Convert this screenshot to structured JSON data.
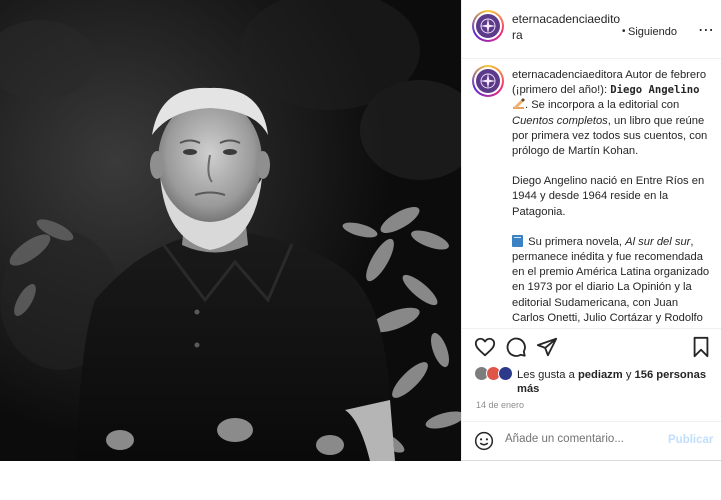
{
  "post": {
    "username": "eternacadenciaeditora",
    "follow_dot": "•",
    "follow_label": "Siguiendo",
    "more_label": "⋯",
    "photo_alt": "",
    "caption": {
      "username": "eternacadenciaeditora",
      "p1_intro": " Autor de febrero (¡primero del año!): ",
      "p1_name": "Diego Angelino",
      "p1_after_name": ". Se incorpora a la editorial con ",
      "p1_title": "Cuentos completos",
      "p1_end": ", un libro que reúne por primera vez todos sus cuentos, con prólogo de Martín Kohan.",
      "p2": "Diego Angelino nació en Entre Ríos en 1944 y desde 1964 reside en la Patagonia.",
      "p3_intro": "Su primera novela, ",
      "p3_title": "Al sur del sur",
      "p3_end": ", permanece inédita y fue recomendada en el premio América Latina organizado en 1973 por el diario La Opinión y la editorial Sudamericana, con Juan Carlos Onetti, Julio Cortázar y Rodolfo Walsh como jurados."
    },
    "likes": {
      "prefix": "Les gusta a ",
      "user": "pediazm",
      "middle": " y ",
      "count": "156 personas",
      "suffix": "más"
    },
    "date": "14 de enero",
    "comment": {
      "placeholder": "Añade un comentario...",
      "post_label": "Publicar"
    }
  },
  "colors": {
    "accent_disabled": "#c0dffd",
    "muted": "#8e8e8e",
    "brand_avatar": "#5b3a8a"
  },
  "icons": [
    "heart-icon",
    "comment-icon",
    "share-icon",
    "bookmark-icon",
    "emoji-icon",
    "more-icon"
  ]
}
